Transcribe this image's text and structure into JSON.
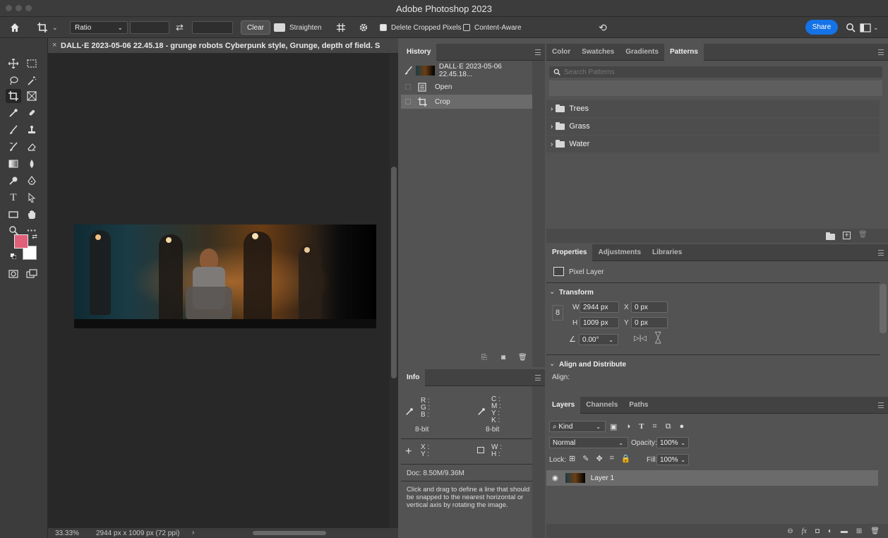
{
  "app": {
    "title": "Adobe Photoshop 2023"
  },
  "options_bar": {
    "ratio_label": "Ratio",
    "clear_label": "Clear",
    "straighten_label": "Straighten",
    "delete_cropped_label": "Delete Cropped Pixels",
    "delete_cropped_checked": true,
    "content_aware_label": "Content-Aware",
    "content_aware_checked": false,
    "share_label": "Share"
  },
  "document": {
    "tab_title": "DALL·E 2023-05-06 22.45.18 - grunge robots Cyberpunk style, Grunge, depth of field. S",
    "zoom": "33.33%",
    "doc_size": "2944 px x 1009 px (72 ppi)"
  },
  "colors": {
    "foreground": "#e0607a",
    "background": "#ffffff",
    "accent": "#1473e6"
  },
  "history": {
    "tab": "History",
    "snapshot": "DALL·E 2023-05-06 22.45.18...",
    "steps": [
      {
        "label": "Open"
      },
      {
        "label": "Crop"
      }
    ]
  },
  "info": {
    "tab": "Info",
    "rgb_labels": [
      "R :",
      "G :",
      "B :"
    ],
    "cmyk_labels": [
      "C :",
      "M :",
      "Y :",
      "K :"
    ],
    "bit_left": "8-bit",
    "bit_right": "8-bit",
    "xy_labels": [
      "X :",
      "Y :"
    ],
    "wh_labels": [
      "W :",
      "H :"
    ],
    "doc": "Doc: 8.50M/9.36M",
    "hint": "Click and drag to define a line that should be snapped to the nearest horizontal or vertical axis by rotating the image."
  },
  "patterns": {
    "tabs": [
      "Color",
      "Swatches",
      "Gradients",
      "Patterns"
    ],
    "active_tab": "Patterns",
    "search_placeholder": "Search Patterns",
    "folders": [
      {
        "label": "Trees"
      },
      {
        "label": "Grass"
      },
      {
        "label": "Water"
      }
    ]
  },
  "properties": {
    "tabs": [
      "Properties",
      "Adjustments",
      "Libraries"
    ],
    "layer_type": "Pixel Layer",
    "transform_title": "Transform",
    "w_label": "W",
    "w_value": "2944 px",
    "h_label": "H",
    "h_value": "1009 px",
    "x_label": "X",
    "x_value": "0 px",
    "y_label": "Y",
    "y_value": "0 px",
    "angle_value": "0.00°",
    "align_title": "Align and Distribute",
    "align_label": "Align:"
  },
  "layers": {
    "tabs": [
      "Layers",
      "Channels",
      "Paths"
    ],
    "kind_label": "Kind",
    "blend_mode": "Normal",
    "opacity_label": "Opacity:",
    "opacity_value": "100%",
    "lock_label": "Lock:",
    "fill_label": "Fill:",
    "fill_value": "100%",
    "items": [
      {
        "name": "Layer 1"
      }
    ]
  }
}
